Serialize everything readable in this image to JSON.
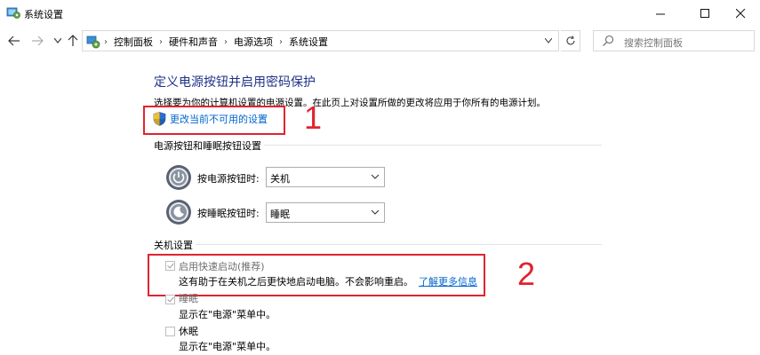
{
  "window": {
    "title": "系统设置"
  },
  "address_bar": {
    "breadcrumbs": [
      "控制面板",
      "硬件和声音",
      "电源选项",
      "系统设置"
    ],
    "search_placeholder": "搜索控制面板"
  },
  "page": {
    "title": "定义电源按钮并启用密码保护",
    "description": "选择要为你的计算机设置的电源设置。在此页上对设置所做的更改将应用于你所有的电源计划。",
    "unlock_link": "更改当前不可用的设置"
  },
  "power_buttons_section": {
    "header": "电源按钮和睡眠按钮设置",
    "power_button": {
      "label": "按电源按钮时:",
      "value": "关机"
    },
    "sleep_button": {
      "label": "按睡眠按钮时:",
      "value": "睡眠"
    }
  },
  "shutdown_section": {
    "header": "关机设置",
    "items": [
      {
        "label": "启用快速启动(推荐)",
        "checked": true,
        "desc": "这有助于在关机之后更快地启动电脑。不会影响重启。",
        "link": "了解更多信息"
      },
      {
        "label": "睡眠",
        "checked": true,
        "desc": "显示在\"电源\"菜单中。"
      },
      {
        "label": "休眠",
        "checked": false,
        "desc": "显示在\"电源\"菜单中。"
      }
    ]
  },
  "annotations": {
    "marker_1": "1",
    "marker_2": "2",
    "highlight_color": "#e0242f"
  },
  "colors": {
    "title_blue": "#1e3287",
    "link_blue": "#0066cc"
  }
}
